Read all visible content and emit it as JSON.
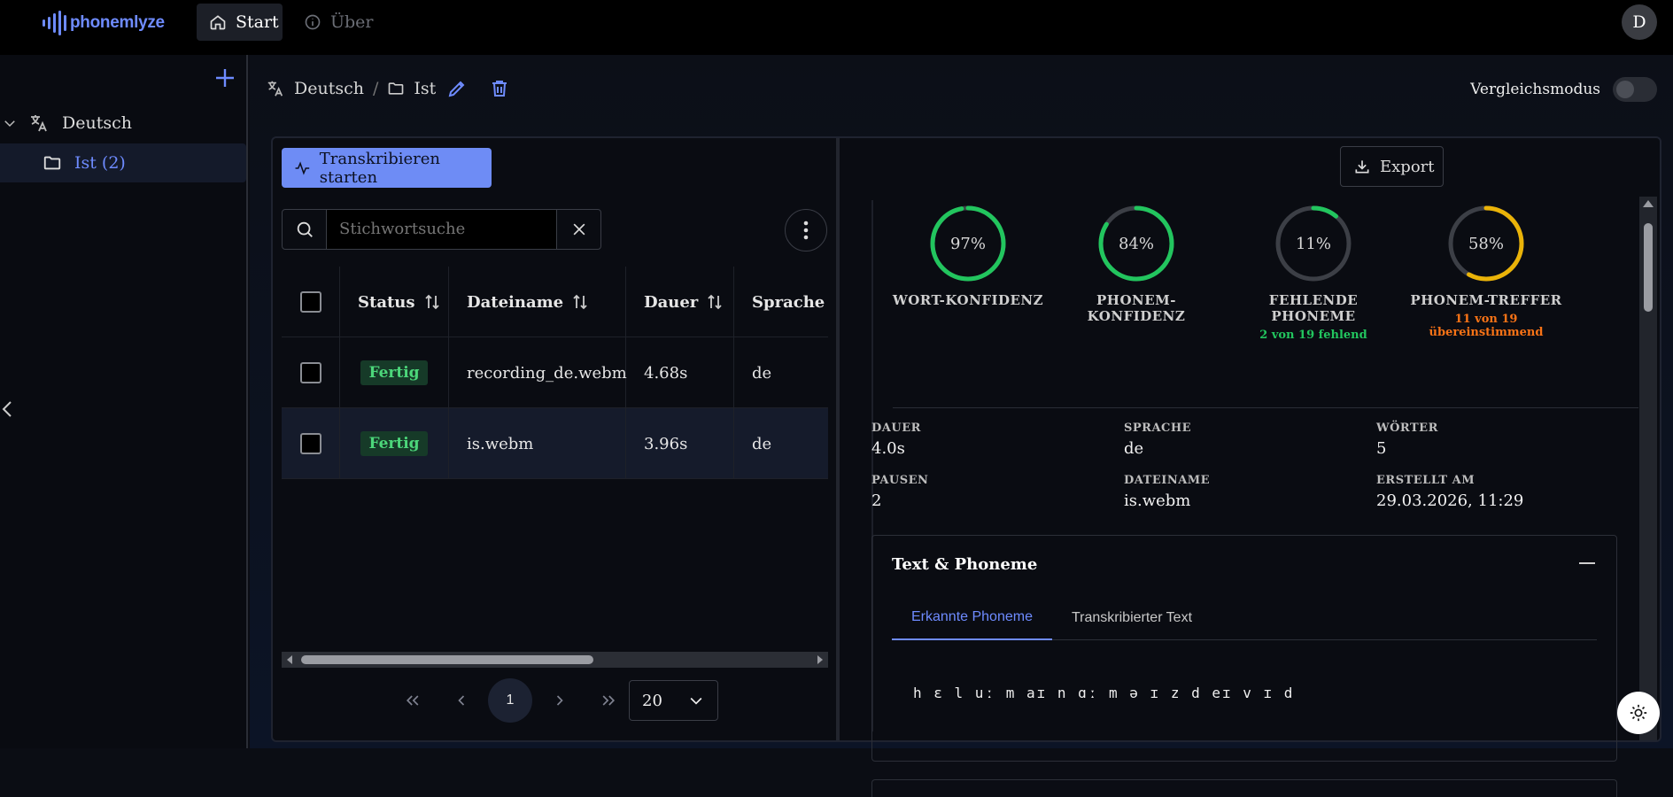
{
  "app": {
    "logo_text": "phonemlyze",
    "nav": {
      "start": "Start",
      "ueber": "Über"
    },
    "avatar": "D"
  },
  "sidebar": {
    "root_label": "Deutsch",
    "child_label": "Ist (2)"
  },
  "breadcrumb": {
    "language": "Deutsch",
    "sep": "/",
    "folder": "Ist"
  },
  "compare_mode_label": "Vergleichsmodus",
  "toolbar": {
    "transcribe_label": "Transkribieren starten",
    "search_placeholder": "Stichwortsuche"
  },
  "table": {
    "headers": {
      "status": "Status",
      "filename": "Dateiname",
      "duration": "Dauer",
      "language": "Sprache"
    },
    "rows": [
      {
        "status": "Fertig",
        "filename": "recording_de.webm",
        "duration": "4.68s",
        "language": "de"
      },
      {
        "status": "Fertig",
        "filename": "is.webm",
        "duration": "3.96s",
        "language": "de"
      }
    ]
  },
  "pagination": {
    "current_page": "1",
    "page_size": "20"
  },
  "details": {
    "export_label": "Export",
    "gauges": [
      {
        "value": "97%",
        "fraction": 0.97,
        "label": "WORT-KONFIDENZ",
        "sub": "",
        "color": "#22c55e"
      },
      {
        "value": "84%",
        "fraction": 0.84,
        "label": "PHONEM-KONFIDENZ",
        "sub": "",
        "color": "#22c55e"
      },
      {
        "value": "11%",
        "fraction": 0.11,
        "label": "FEHLENDE PHONEME",
        "sub": "2 von 19 fehlend",
        "color": "#22c55e"
      },
      {
        "value": "58%",
        "fraction": 0.58,
        "label": "PHONEM-TREFFER",
        "sub": "11 von 19 übereinstimmend",
        "color": "#eab308"
      }
    ],
    "meta": {
      "dauer_label": "DAUER",
      "dauer": "4.0s",
      "sprache_label": "SPRACHE",
      "sprache": "de",
      "woerter_label": "WÖRTER",
      "woerter": "5",
      "pausen_label": "PAUSEN",
      "pausen": "2",
      "dateiname_label": "DATEINAME",
      "dateiname": "is.webm",
      "erstellt_label": "ERSTELLT AM",
      "erstellt": "29.03.2026, 11:29"
    },
    "text_phonemes": {
      "title": "Text & Phoneme",
      "tab_phonemes": "Erkannte Phoneme",
      "tab_text": "Transkribierter Text",
      "phonemes": "h ɛ l uː m aɪ n ɑː m ə ɪ z d eɪ v ɪ d"
    }
  },
  "colors": {
    "accent": "#6e8bff",
    "success": "#22c55e",
    "warning": "#eab308",
    "sub_green": "#22c55e",
    "sub_orange": "#f97316"
  }
}
